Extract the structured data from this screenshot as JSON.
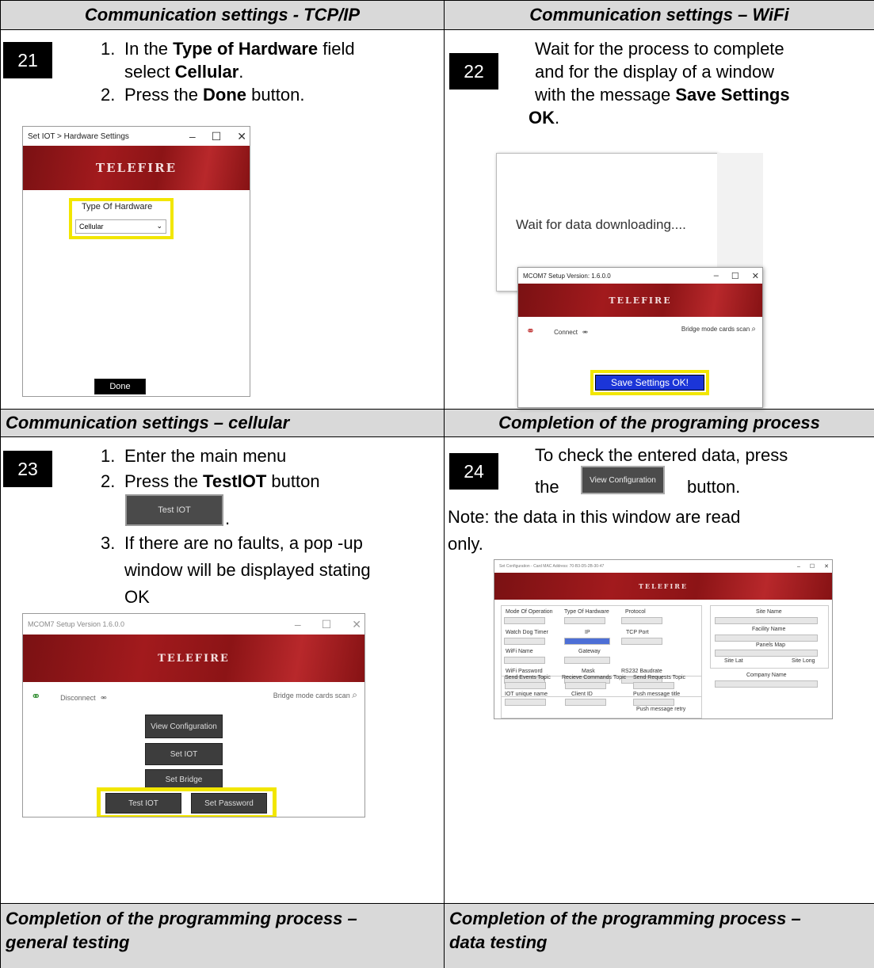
{
  "headers": {
    "tcp": "Communication settings - TCP/IP",
    "wifi": "Communication settings – WiFi",
    "cellular": "Communication settings – cellular",
    "completion": "Completion of the programing process",
    "general1": "Completion of the programming process –",
    "general2": "general testing",
    "data1": "Completion of the programming process –",
    "data2": "data testing"
  },
  "step21": {
    "num": "21",
    "i1a": "1.",
    "i1b": "In the ",
    "i1c": "Type of Hardware",
    "i1d": " field",
    "i1e": "select ",
    "i1f": "Cellular",
    "i1g": ".",
    "i2a": "2.",
    "i2b": "Press the ",
    "i2c": "Done",
    "i2d": " button.",
    "win": {
      "title": "Set IOT > Hardware Settings",
      "logo": "TELEFIRE",
      "field_label": "Type Of Hardware",
      "select_value": "Cellular",
      "done": "Done"
    }
  },
  "step22": {
    "num": "22",
    "l1": "Wait for the process to complete",
    "l2": "and for the display of a window",
    "l3a": "with the message ",
    "l3b": "Save Settings",
    "l4a": "OK",
    "l4b": ".",
    "wait_text": "Wait for data downloading....",
    "win": {
      "title": "MCOM7 Setup Version: 1.6.0.0",
      "logo": "TELEFIRE",
      "connect": "Connect",
      "bridge": "Bridge mode cards scan",
      "ok": "Save Settings OK!"
    }
  },
  "step23": {
    "num": "23",
    "i1a": "1.",
    "i1b": "Enter the main menu",
    "i2a": "2.",
    "i2b": "Press the ",
    "i2c": "TestIOT",
    "i2d": " button",
    "btn": "Test IOT",
    "dot": ".",
    "i3a": "3.",
    "i3b": "If there are no faults, a pop -up",
    "i3c": "window will be displayed stating",
    "i3d": "OK",
    "win": {
      "title": "MCOM7 Setup Version 1.6.0.0",
      "logo": "TELEFIRE",
      "disconnect": "Disconnect",
      "bridge": "Bridge mode cards scan",
      "b_view": "View Configuration",
      "b_setiot": "Set IOT",
      "b_bridge": "Set Bridge",
      "b_test": "Test IOT",
      "b_pass": "Set Password"
    }
  },
  "step24": {
    "num": "24",
    "l1": "To check the entered data, press",
    "l2a": "the",
    "btn": "View Configuration",
    "l2b": "button.",
    "l3": "Note: the data in this window are read",
    "l4": "only.",
    "win": {
      "title": "Set Configuration - Card MAC Address: 70-B3-D5-2B-30-47",
      "logo": "TELEFIRE",
      "labels": {
        "mode": "Mode Of Operation",
        "hw": "Type Of Hardware",
        "proto": "Protocol",
        "wd": "Watch Dog Timer",
        "ip": "IP",
        "port": "TCP Port",
        "wifi": "WiFi Name",
        "gw": "Gateway",
        "wpass": "WiFi Password",
        "mask": "Mask",
        "baud": "RS232 Baudrate",
        "site": "Site Name",
        "facility": "Facility Name",
        "panels": "Panels Map",
        "lat": "Site Lat",
        "long": "Site Long",
        "company": "Company Name",
        "send": "Send Events Topic",
        "recv": "Recieve Commands Topic",
        "req": "Send Requests Topic",
        "iot": "IOT unique name",
        "client": "Client ID",
        "ptitle": "Push message title",
        "pretry": "Push message retry"
      }
    }
  }
}
